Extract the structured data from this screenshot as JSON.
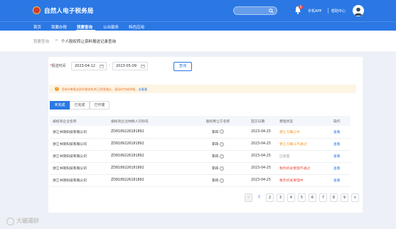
{
  "header": {
    "title": "自然人电子税务局",
    "search_placeholder": "",
    "notification_count": "5",
    "phone_app": "手机APP",
    "help_center": "帮助中心"
  },
  "nav": {
    "items": [
      {
        "label": "首页"
      },
      {
        "label": "我要办税"
      },
      {
        "label": "我要查询"
      },
      {
        "label": "公众服务"
      },
      {
        "label": "特色应用"
      }
    ]
  },
  "breadcrumb": {
    "home": "我要查询",
    "separator": ">",
    "current": "个人股权转让资料报送记录查询"
  },
  "filter": {
    "date_label": "报送时间",
    "required_mark": "*",
    "start_date": "2023-04-12",
    "end_date": "2023-05-09",
    "dash": "-",
    "query_button": "查询"
  },
  "notice": {
    "text": "您有X笔报送资料税务机关已受理通过，请及时完成申报。",
    "link": "去看看"
  },
  "tabs": [
    {
      "label": "未完成"
    },
    {
      "label": "已完成"
    },
    {
      "label": "已作废"
    }
  ],
  "table": {
    "columns": [
      "被投资企业名称",
      "被投资企业纳税人识别号",
      "股权受让方名称",
      "提交日期",
      "受理状态",
      "操作"
    ],
    "rows": [
      {
        "name": "浙江书简科技有限公司",
        "tax_id": "ZD8189226181892",
        "transferee": "李四",
        "date": "2023-04-25",
        "status": "受让方确认中",
        "action": "查看"
      },
      {
        "name": "浙江书简科技有限公司",
        "tax_id": "ZD8189226181892",
        "transferee": "李四",
        "date": "2023-04-25",
        "status": "受让方确认不通过",
        "action": "查看"
      },
      {
        "name": "浙江书简科技有限公司",
        "tax_id": "ZD8189226181892",
        "transferee": "李四",
        "date": "2023-04-25",
        "status": "已驳回",
        "action": "查看"
      },
      {
        "name": "浙江书简科技有限公司",
        "tax_id": "ZD8189226181892",
        "transferee": "李四",
        "date": "2023-04-25",
        "status": "税务机关受理不通过",
        "action": "查看"
      },
      {
        "name": "浙江书简科技有限公司",
        "tax_id": "ZD8189226181892",
        "transferee": "李四",
        "date": "2023-04-25",
        "status": "税务机关受理中",
        "action": "查看"
      }
    ]
  },
  "pagination": {
    "prev": "<",
    "pages": [
      "1",
      "2",
      "3",
      "4",
      "5",
      "6",
      "7",
      "8",
      "9"
    ],
    "current": "1",
    "next": ">"
  },
  "watermark": "大磁遁砂",
  "colors": {
    "primary": "#2b78e4",
    "warning": "#f59a23",
    "danger": "#e94b3c",
    "muted": "#999999"
  }
}
